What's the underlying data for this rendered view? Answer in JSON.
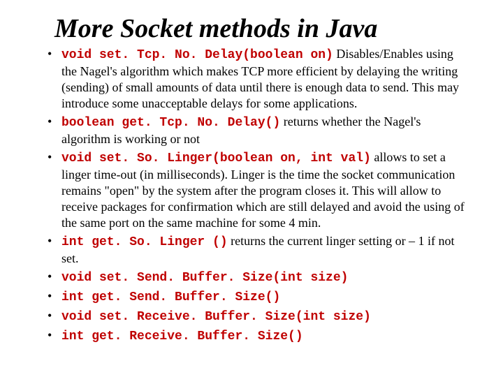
{
  "title": "More Socket methods in Java",
  "items": [
    {
      "code": "void set. Tcp. No. Delay(boolean on)",
      "text": " Disables/Enables using the Nagel's algorithm which makes TCP more efficient by delaying the writing (sending) of small amounts of data until there is enough data to send. This may introduce some unacceptable delays for some applications."
    },
    {
      "code": "boolean get. Tcp. No. Delay()",
      "text": " returns whether the Nagel's algorithm is working or not"
    },
    {
      "code": "void set. So. Linger(boolean on, int val)",
      "text": " allows to set a linger time-out (in milliseconds). Linger is the time the socket communication remains \"open\" by the system after the program closes it. This will allow to receive packages for confirmation which are still delayed and avoid the using of the same port on the same machine for some 4 min."
    },
    {
      "code": "int  get. So. Linger ()",
      "text": " returns the current linger setting or – 1 if not set."
    },
    {
      "code": "void set. Send. Buffer. Size(int size)",
      "text": ""
    },
    {
      "code": "int  get. Send. Buffer. Size()",
      "text": ""
    },
    {
      "code": "void set. Receive. Buffer. Size(int size)",
      "text": ""
    },
    {
      "code": "int  get. Receive. Buffer. Size()",
      "text": ""
    }
  ]
}
